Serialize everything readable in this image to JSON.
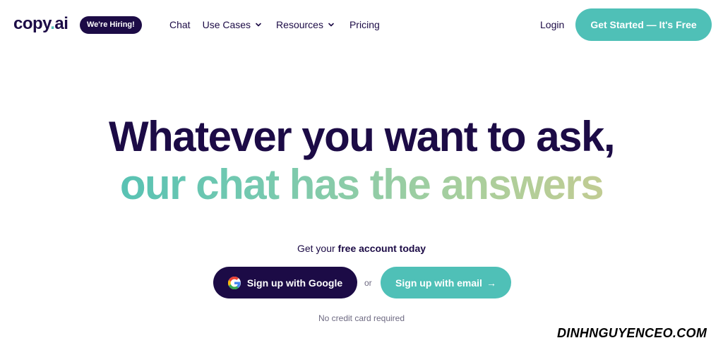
{
  "header": {
    "logo_main": "copy",
    "logo_dot": ".",
    "logo_suffix": "ai",
    "hiring_badge": "We're Hiring!",
    "nav": {
      "chat": "Chat",
      "use_cases": "Use Cases",
      "resources": "Resources",
      "pricing": "Pricing"
    },
    "login": "Login",
    "cta": "Get Started — It's Free"
  },
  "hero": {
    "line1": "Whatever you want to ask,",
    "line2": "our chat has the answers",
    "subtitle_prefix": "Get your ",
    "subtitle_bold": "free account today",
    "google_button": "Sign up with Google",
    "or": "or",
    "email_button": "Sign up with email",
    "email_arrow": "→",
    "note": "No credit card required"
  },
  "watermark": "DINHNGUYENCEO.COM",
  "colors": {
    "brand_dark": "#1c0b46",
    "brand_teal": "#4fc0b7",
    "gradient_start": "#3fbcb6",
    "gradient_end": "#d6c98a"
  }
}
